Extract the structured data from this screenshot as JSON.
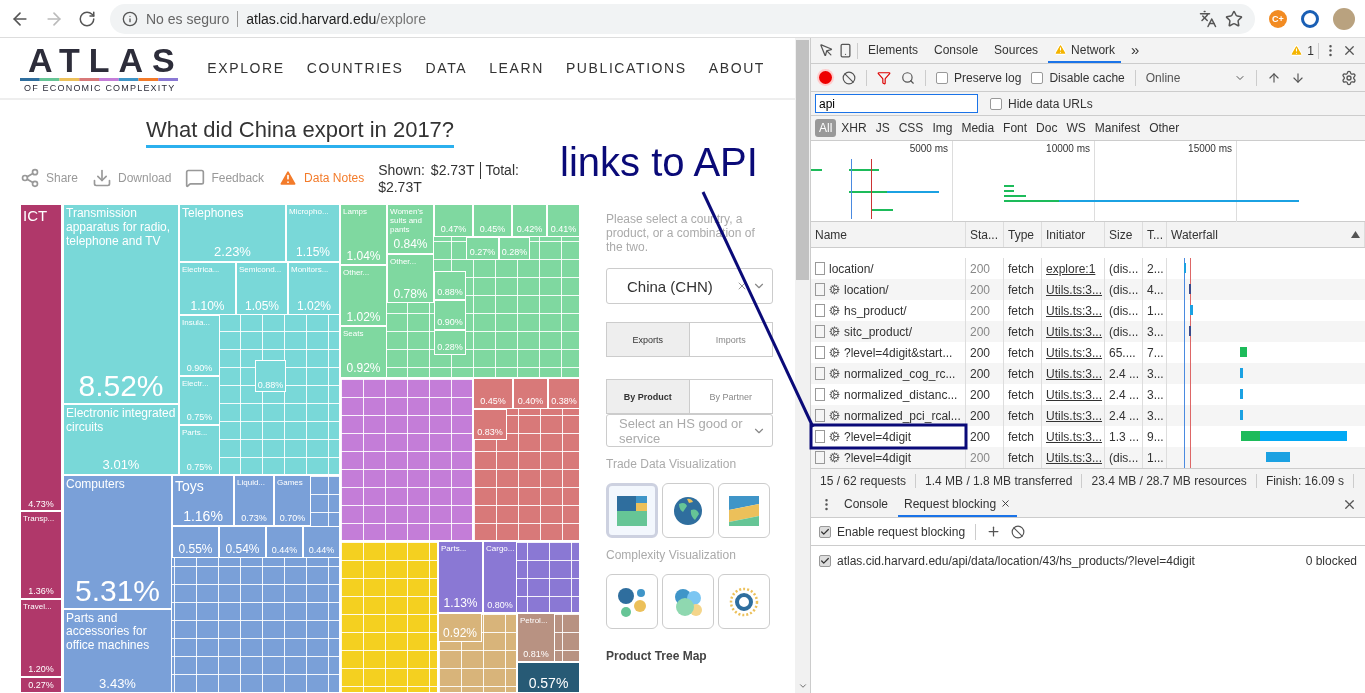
{
  "browser": {
    "security": "No es seguro",
    "url_host": "atlas.cid.harvard.edu",
    "url_path": "/explore",
    "extension_label": "C+"
  },
  "site": {
    "logo": "ATLAS",
    "logo_tagline": "OF ECONOMIC COMPLEXITY",
    "nav": [
      "EXPLORE",
      "COUNTRIES",
      "DATA",
      "LEARN",
      "PUBLICATIONS",
      "ABOUT"
    ],
    "title": "What did China export in 2017?",
    "actions": [
      {
        "label": "Share",
        "kind": "share"
      },
      {
        "label": "Download",
        "kind": "download"
      },
      {
        "label": "Feedback",
        "kind": "feedback"
      },
      {
        "label": "Data Notes",
        "kind": "notes"
      }
    ],
    "shown_label": "Shown:",
    "shown_value": "$2.73T",
    "total_label": "Total:",
    "total_value": "$2.73T",
    "sections": [
      {
        "color": "#79d8d8"
      },
      {
        "color": "#7aa0d8"
      },
      {
        "color": "#7fd8a0"
      },
      {
        "color": "#c47dd8"
      },
      {
        "color": "#d87979"
      },
      {
        "color": "#f4d020"
      },
      {
        "color": "#8a78d4"
      },
      {
        "color": "#d8b47a"
      },
      {
        "color": "#b89282"
      }
    ],
    "tiles": [
      {
        "name": "ICT",
        "share": "4.73%",
        "color": "#b0386a"
      },
      {
        "name": "Transp...",
        "share": "1.36%",
        "color": "#b0386a"
      },
      {
        "name": "Travel...",
        "share": "1.20%",
        "color": "#b0386a"
      },
      {
        "share": "0.27%",
        "color": "#b0386a"
      },
      {
        "name": "Transmission apparatus for radio, telephone and TV",
        "share": "8.52%",
        "color": "#79d8d8"
      },
      {
        "name": "Electronic integrated circuits",
        "share": "3.01%",
        "color": "#79d8d8"
      },
      {
        "name": "Telephones",
        "share": "2.23%",
        "color": "#79d8d8"
      },
      {
        "name": "Micropho...",
        "share": "1.15%",
        "color": "#79d8d8"
      },
      {
        "name": "Electrica...",
        "share": "1.10%",
        "color": "#79d8d8"
      },
      {
        "name": "Semicond...",
        "share": "1.05%",
        "color": "#79d8d8"
      },
      {
        "name": "Monitors...",
        "share": "1.02%",
        "color": "#79d8d8"
      },
      {
        "name": "Insula...",
        "share": "0.90%",
        "color": "#79d8d8"
      },
      {
        "name": "Electr...",
        "share": "0.75%",
        "color": "#79d8d8"
      },
      {
        "name": "Parts...",
        "share": "0.75%",
        "color": "#79d8d8"
      },
      {
        "share": "0.88%",
        "color": "#79d8d8"
      },
      {
        "name": "Computers",
        "share": "5.31%",
        "color": "#7aa0d8"
      },
      {
        "name": "Parts and accessories for office machines",
        "share": "3.43%",
        "color": "#7aa0d8"
      },
      {
        "name": "Toys",
        "share": "1.16%",
        "color": "#7aa0d8"
      },
      {
        "name": "Liquid...",
        "share": "0.73%",
        "color": "#7aa0d8"
      },
      {
        "name": "Games",
        "share": "0.70%",
        "color": "#7aa0d8"
      },
      {
        "share": "0.55%",
        "color": "#7aa0d8"
      },
      {
        "share": "0.54%",
        "color": "#7aa0d8"
      },
      {
        "share": "0.44%",
        "color": "#7aa0d8"
      },
      {
        "share": "0.44%",
        "color": "#7aa0d8"
      },
      {
        "name": "Lamps",
        "share": "1.04%",
        "color": "#7fd8a0"
      },
      {
        "name": "Women's suits and pants",
        "share": "0.84%",
        "color": "#7fd8a0"
      },
      {
        "name": "Other...",
        "share": "1.02%",
        "color": "#7fd8a0"
      },
      {
        "name": "Other...",
        "share": "0.78%",
        "color": "#7fd8a0"
      },
      {
        "name": "Seats",
        "share": "0.92%",
        "color": "#7fd8a0"
      },
      {
        "share": "0.47%",
        "color": "#7fd8a0"
      },
      {
        "share": "0.45%",
        "color": "#7fd8a0"
      },
      {
        "share": "0.42%",
        "color": "#7fd8a0"
      },
      {
        "share": "0.41%",
        "color": "#7fd8a0"
      },
      {
        "share": "0.27%",
        "color": "#7fd8a0"
      },
      {
        "share": "0.28%",
        "color": "#7fd8a0"
      },
      {
        "share": "0.88%",
        "color": "#7fd8a0"
      },
      {
        "share": "0.90%",
        "color": "#7fd8a0"
      },
      {
        "share": "0.28%",
        "color": "#7fd8a0"
      },
      {
        "share": "0.45%",
        "color": "#d87979"
      },
      {
        "share": "0.40%",
        "color": "#d87979"
      },
      {
        "share": "0.38%",
        "color": "#d87979"
      },
      {
        "share": "0.83%",
        "color": "#d87979"
      },
      {
        "name": "Parts...",
        "share": "1.13%",
        "color": "#8a78d4"
      },
      {
        "name": "Cargo...",
        "share": "0.80%",
        "color": "#8a78d4"
      },
      {
        "share": "0.92%",
        "color": "#d8b47a"
      },
      {
        "name": "Petrol...",
        "share": "0.81%",
        "color": "#b89282"
      },
      {
        "share": "0.57%",
        "color": "#275a75"
      }
    ],
    "sidebar": {
      "prompt": "Please select a country, a product, or a combination of the two.",
      "country": "China (CHN)",
      "flow_tabs": [
        {
          "label": "Exports",
          "selected": true
        },
        {
          "label": "Imports",
          "selected": false
        }
      ],
      "group_tabs": [
        {
          "label": "By Product",
          "selected": true
        },
        {
          "label": "By Partner",
          "selected": false
        }
      ],
      "product_placeholder": "Select an HS good or service",
      "trade_heading": "Trade Data Visualization",
      "trade_views": [
        {
          "kind": "treemap",
          "selected": true
        },
        {
          "kind": "globe",
          "selected": false
        },
        {
          "kind": "area",
          "selected": false
        }
      ],
      "complexity_heading": "Complexity Visualization",
      "complexity_views": [
        {
          "kind": "network",
          "selected": false
        },
        {
          "kind": "bubbles",
          "selected": false
        },
        {
          "kind": "ring",
          "selected": false
        }
      ],
      "current_view": "Product Tree Map"
    }
  },
  "annotation": {
    "text": "links to API"
  },
  "devtools": {
    "tabs": [
      {
        "label": "Elements",
        "selected": false,
        "warning": false
      },
      {
        "label": "Console",
        "selected": false,
        "warning": false
      },
      {
        "label": "Sources",
        "selected": false,
        "warning": false
      },
      {
        "label": "Network",
        "selected": true,
        "warning": true
      }
    ],
    "overflow": "»",
    "warning_count": "1",
    "preserve_log": {
      "label": "Preserve log",
      "checked": false
    },
    "disable_cache": {
      "label": "Disable cache",
      "checked": false
    },
    "throttling": "Online",
    "filter": {
      "value": "api"
    },
    "hide_data_urls": {
      "label": "Hide data URLs",
      "checked": false
    },
    "types": [
      {
        "label": "All",
        "selected": true
      },
      {
        "label": "XHR",
        "selected": false
      },
      {
        "label": "JS",
        "selected": false
      },
      {
        "label": "CSS",
        "selected": false
      },
      {
        "label": "Img",
        "selected": false
      },
      {
        "label": "Media",
        "selected": false
      },
      {
        "label": "Font",
        "selected": false
      },
      {
        "label": "Doc",
        "selected": false
      },
      {
        "label": "WS",
        "selected": false
      },
      {
        "label": "Manifest",
        "selected": false
      },
      {
        "label": "Other",
        "selected": false
      }
    ],
    "overview_ticks": [
      "5000 ms",
      "10000 ms",
      "15000 ms"
    ],
    "columns": [
      "Name",
      "Sta...",
      "Type",
      "Initiator",
      "Size",
      "T...",
      "Waterfall"
    ],
    "rows": [
      {
        "name": "location/",
        "worker": false,
        "status": "200",
        "dimmed": true,
        "type": "fetch",
        "initiator": "explore:1",
        "size": "(dis...",
        "time": "2..."
      },
      {
        "name": "location/",
        "worker": true,
        "status": "200",
        "dimmed": true,
        "type": "fetch",
        "initiator": "Utils.ts:3...",
        "size": "(dis...",
        "time": "4..."
      },
      {
        "name": "hs_product/",
        "worker": true,
        "status": "200",
        "dimmed": true,
        "type": "fetch",
        "initiator": "Utils.ts:3...",
        "size": "(dis...",
        "time": "1..."
      },
      {
        "name": "sitc_product/",
        "worker": true,
        "status": "200",
        "dimmed": true,
        "type": "fetch",
        "initiator": "Utils.ts:3...",
        "size": "(dis...",
        "time": "3..."
      },
      {
        "name": "?level=4digit&start...",
        "worker": true,
        "status": "200",
        "dimmed": false,
        "type": "fetch",
        "initiator": "Utils.ts:3...",
        "size": "65....",
        "time": "7..."
      },
      {
        "name": "normalized_cog_rc...",
        "worker": true,
        "status": "200",
        "dimmed": false,
        "type": "fetch",
        "initiator": "Utils.ts:3...",
        "size": "2.4 ...",
        "time": "3..."
      },
      {
        "name": "normalized_distanc...",
        "worker": true,
        "status": "200",
        "dimmed": false,
        "type": "fetch",
        "initiator": "Utils.ts:3...",
        "size": "2.4 ...",
        "time": "3..."
      },
      {
        "name": "normalized_pci_rcal...",
        "worker": true,
        "status": "200",
        "dimmed": false,
        "type": "fetch",
        "initiator": "Utils.ts:3...",
        "size": "2.4 ...",
        "time": "3..."
      },
      {
        "name": "?level=4digit",
        "worker": true,
        "status": "200",
        "dimmed": false,
        "type": "fetch",
        "initiator": "Utils.ts:3...",
        "size": "1.3 ...",
        "time": "9..."
      },
      {
        "name": "?level=4digit",
        "worker": true,
        "status": "200",
        "dimmed": true,
        "type": "fetch",
        "initiator": "Utils.ts:3...",
        "size": "(dis...",
        "time": "1..."
      }
    ],
    "summary": [
      "15 / 62 requests",
      "1.4 MB / 1.8 MB transferred",
      "23.4 MB / 28.7 MB resources",
      "Finish: 16.09 s"
    ],
    "drawer_tabs": [
      {
        "label": "Console",
        "selected": false,
        "closable": false
      },
      {
        "label": "Request blocking",
        "selected": true,
        "closable": true
      }
    ],
    "enable_blocking": {
      "label": "Enable request blocking",
      "checked": true
    },
    "patterns": [
      {
        "pattern": "atlas.cid.harvard.edu/api/data/location/43/hs_products/?level=4digit",
        "checked": true,
        "count": "0 blocked"
      }
    ]
  }
}
